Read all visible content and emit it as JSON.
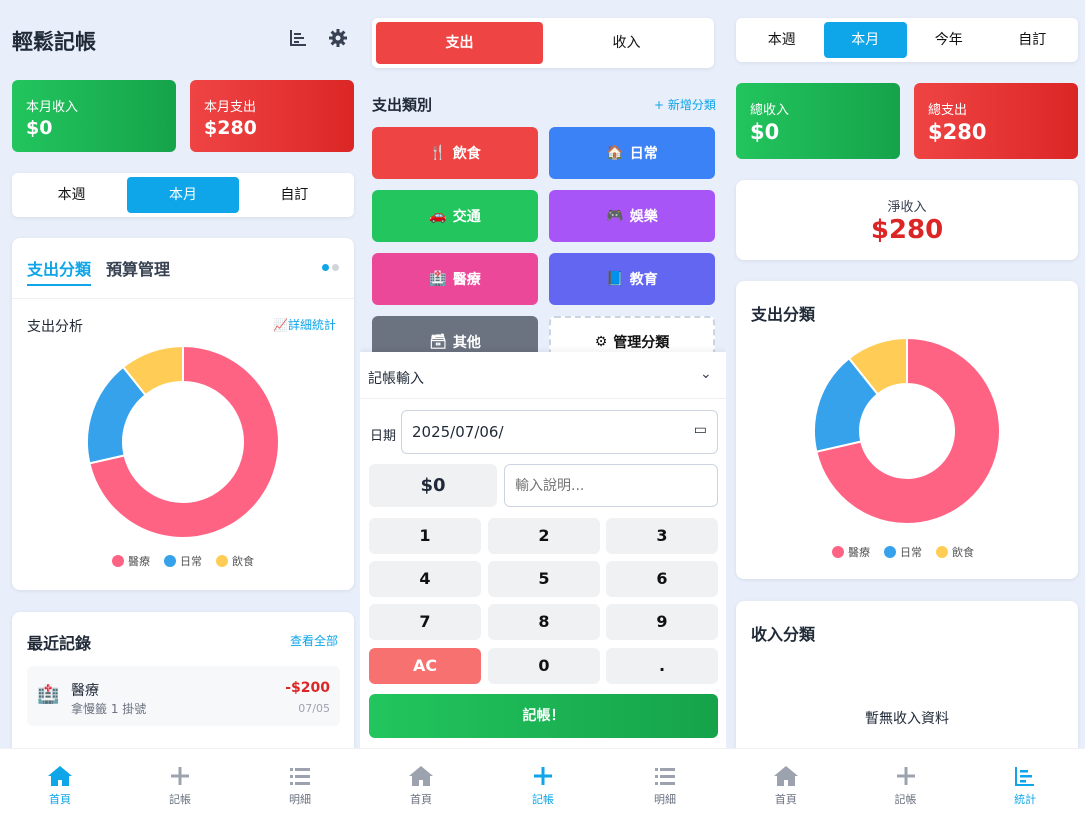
{
  "p1": {
    "title": "輕鬆記帳",
    "income_label": "本月收入",
    "income_value": "$0",
    "expense_label": "本月支出",
    "expense_value": "$280",
    "periods": [
      "本週",
      "本月",
      "自訂"
    ],
    "tabs": [
      "支出分類",
      "預算管理"
    ],
    "analysis_title": "支出分析",
    "detail_link": "詳細統計",
    "recent_title": "最近記錄",
    "view_all": "查看全部",
    "record": {
      "category": "醫療",
      "note": "拿慢籤 1 掛號",
      "amount": "-$200",
      "date": "07/05"
    }
  },
  "p2": {
    "type_tabs": [
      "支出",
      "收入"
    ],
    "categories_title": "支出類別",
    "add_category": "+ 新增分類",
    "categories": [
      "飲食",
      "日常",
      "交通",
      "娛樂",
      "醫療",
      "教育",
      "其他",
      "管理分類"
    ],
    "entry_title": "記帳輸入",
    "date_label": "日期",
    "date_value": "2025/07/06/",
    "amount": "$0",
    "desc_placeholder": "輸入說明...",
    "keys": [
      "1",
      "2",
      "3",
      "4",
      "5",
      "6",
      "7",
      "8",
      "9",
      "AC",
      "0",
      "."
    ],
    "submit": "記帳！"
  },
  "p3": {
    "periods": [
      "本週",
      "本月",
      "今年",
      "自訂"
    ],
    "income_label": "總收入",
    "income_value": "$0",
    "expense_label": "總支出",
    "expense_value": "$280",
    "net_label": "淨收入",
    "net_value": "$280",
    "expense_title": "支出分類",
    "income_title": "收入分類",
    "no_income": "暫無收入資料"
  },
  "nav": {
    "home": "首頁",
    "add": "記帳",
    "list": "明細",
    "stats": "統計"
  },
  "colors": {
    "accent": "#0ea5e9",
    "medical": "#ff6384",
    "daily": "#36a2eb",
    "food": "#ffcd56"
  },
  "chart_data": {
    "type": "pie",
    "categories": [
      "醫療",
      "日常",
      "飲食"
    ],
    "values": [
      200,
      50,
      30
    ],
    "colors": [
      "#ff6384",
      "#36a2eb",
      "#ffcd56"
    ]
  }
}
